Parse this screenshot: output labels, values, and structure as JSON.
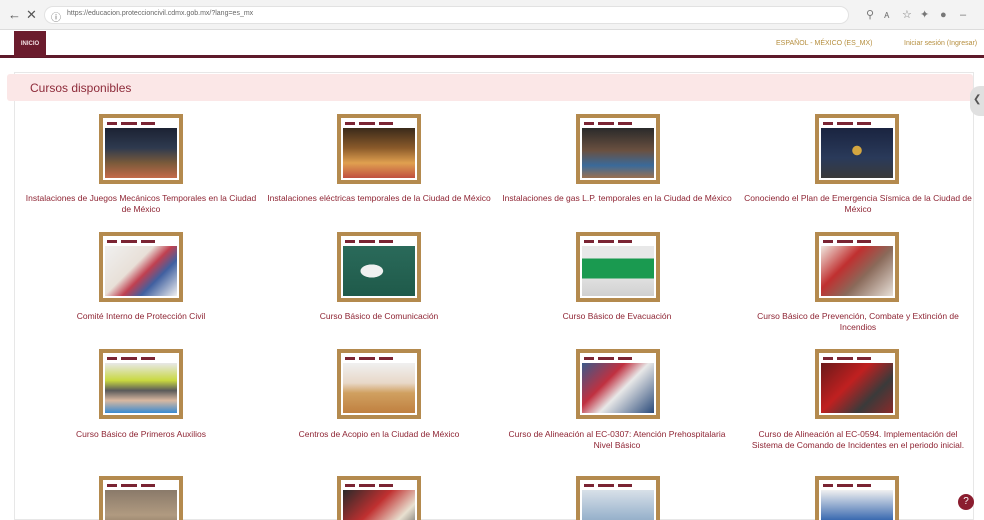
{
  "browser": {
    "back_icon": "arrow-left-icon",
    "close_icon": "close-icon",
    "url": "https://educacion.proteccioncivil.cdmx.gob.mx/?lang=es_mx",
    "toolbar_icons": [
      "search-icon",
      "read-aloud-icon",
      "favorite-icon",
      "extensions-icon",
      "profile-icon",
      "more-icon"
    ]
  },
  "header": {
    "brand_label": "INICIO",
    "language_label": "ESPAÑOL - MÉXICO (ES_MX)",
    "login_label": "Iniciar sesión (Ingresar)"
  },
  "panel": {
    "title": "Cursos disponibles"
  },
  "courses": [
    {
      "title": "Instalaciones de Juegos Mecánicos Temporales en la Ciudad de México"
    },
    {
      "title": "Instalaciones eléctricas temporales de la Ciudad de México"
    },
    {
      "title": "Instalaciones de gas L.P. temporales en la Ciudad de México"
    },
    {
      "title": "Conociendo el Plan de Emergencia Sísmica de la Ciudad de México"
    },
    {
      "title": "Comité Interno de Protección Civil"
    },
    {
      "title": "Curso Básico de Comunicación"
    },
    {
      "title": "Curso Básico de Evacuación"
    },
    {
      "title": "Curso Básico de Prevención, Combate y Extinción de Incendios"
    },
    {
      "title": "Curso Básico de Primeros Auxilios"
    },
    {
      "title": "Centros de Acopio en la Ciudad de México"
    },
    {
      "title": "Curso de Alineación al EC-0307: Atención Prehospitalaria Nivel Básico"
    },
    {
      "title": "Curso de Alineación al EC-0594. Implementación del Sistema de Comando de Incidentes en el periodo inicial."
    }
  ],
  "help_label": "?",
  "colors": {
    "brand": "#6b1c2d",
    "link": "#8e2433",
    "title_bar": "#fbe7e7",
    "thumb_frame": "#b48a4e"
  }
}
